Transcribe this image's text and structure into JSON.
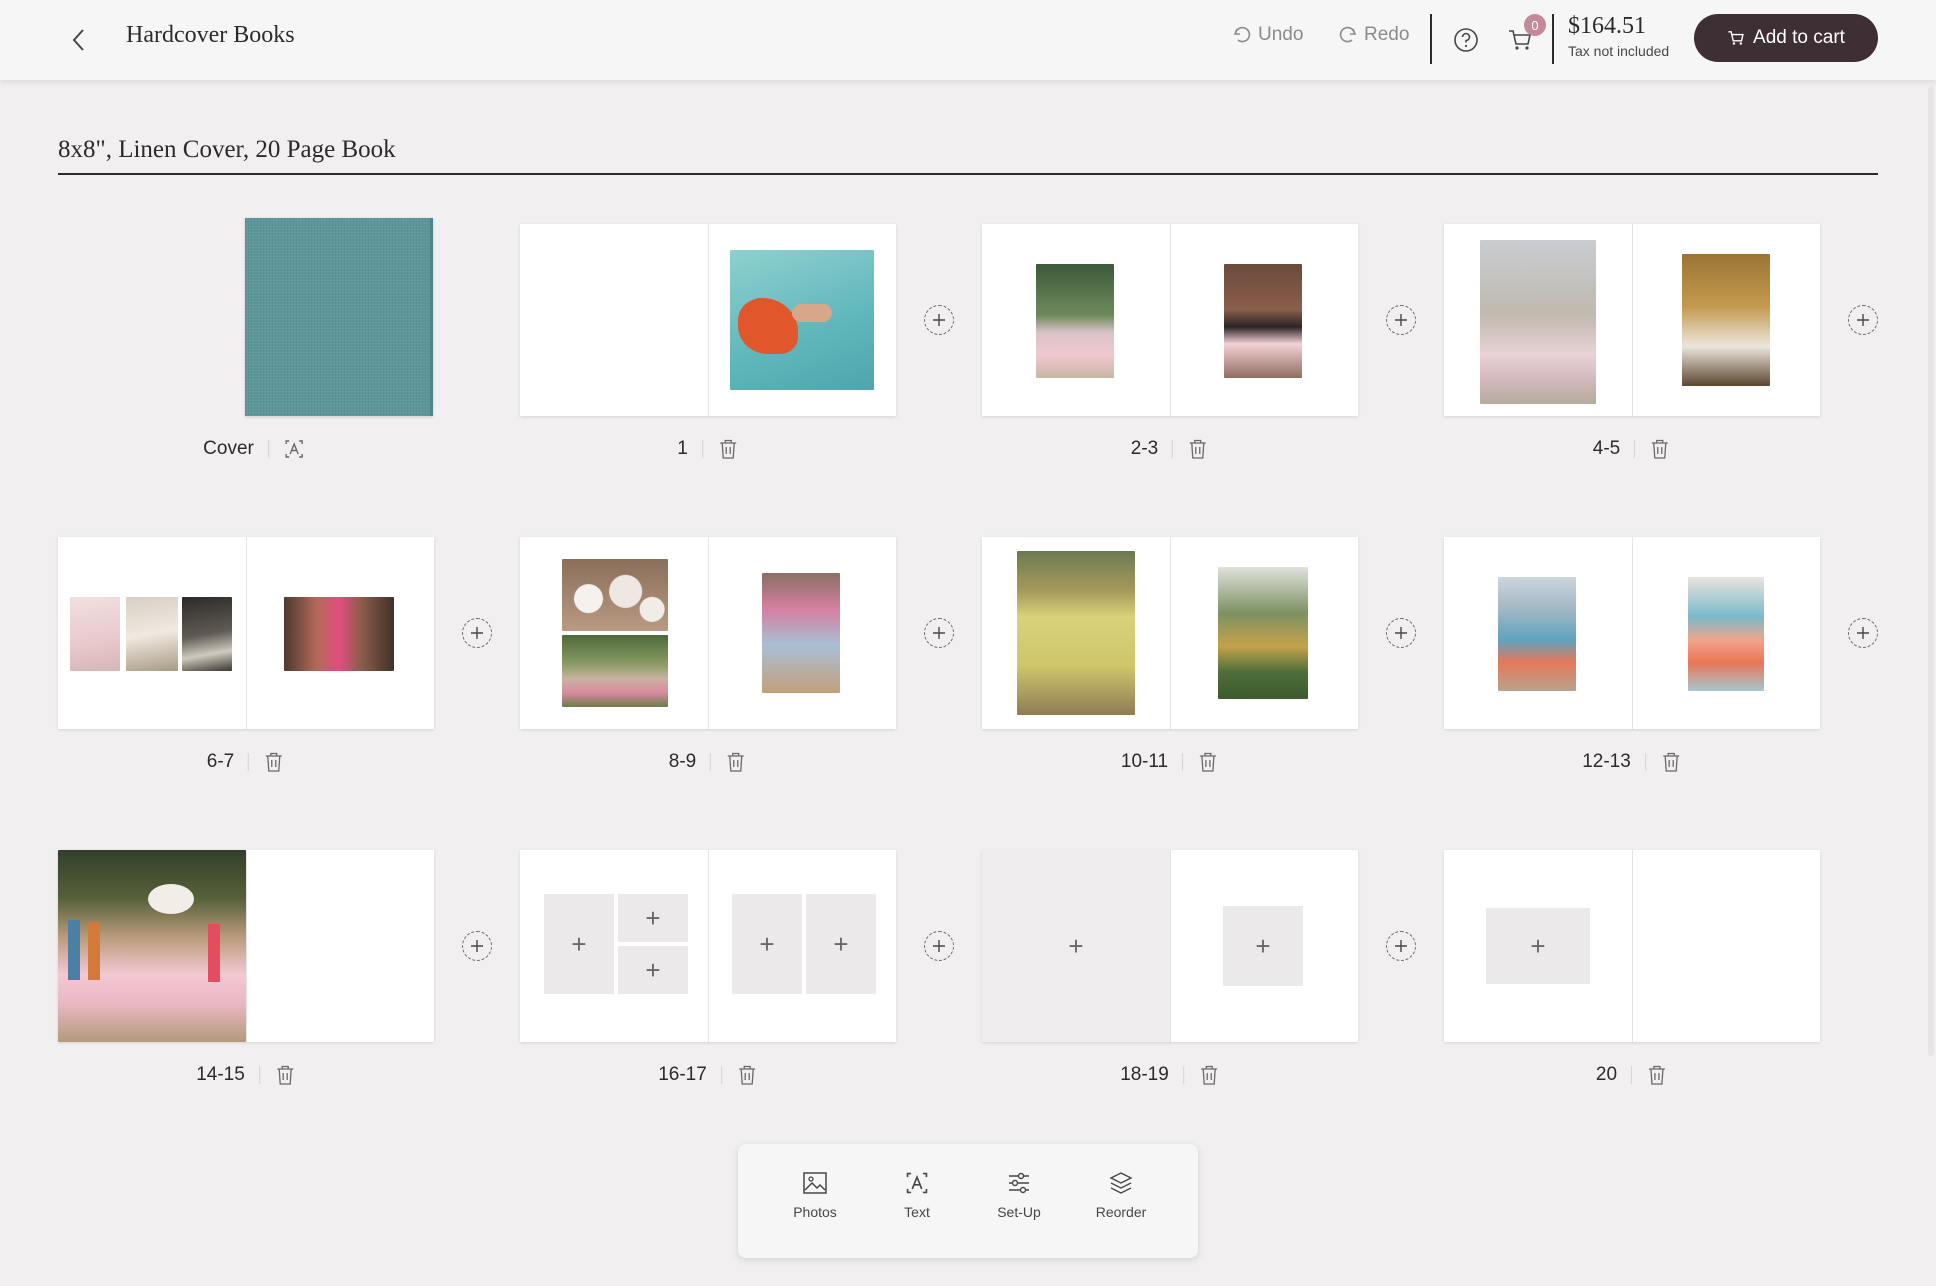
{
  "header": {
    "title": "Hardcover Books",
    "undo_label": "Undo",
    "redo_label": "Redo",
    "cart_count": "0",
    "price": "$164.51",
    "tax_note": "Tax not included",
    "add_to_cart_label": "Add to cart"
  },
  "book": {
    "title": "8x8\", Linen Cover, 20 Page Book",
    "cover_color": "#5e979b"
  },
  "spreads": [
    {
      "label": "Cover",
      "action_icon": "text-icon"
    },
    {
      "label": "1",
      "action_icon": "trash-icon"
    },
    {
      "label": "2-3",
      "action_icon": "trash-icon"
    },
    {
      "label": "4-5",
      "action_icon": "trash-icon"
    },
    {
      "label": "6-7",
      "action_icon": "trash-icon"
    },
    {
      "label": "8-9",
      "action_icon": "trash-icon"
    },
    {
      "label": "10-11",
      "action_icon": "trash-icon"
    },
    {
      "label": "12-13",
      "action_icon": "trash-icon"
    },
    {
      "label": "14-15",
      "action_icon": "trash-icon"
    },
    {
      "label": "16-17",
      "action_icon": "trash-icon"
    },
    {
      "label": "18-19",
      "action_icon": "trash-icon"
    },
    {
      "label": "20",
      "action_icon": "trash-icon"
    }
  ],
  "toolbar": {
    "items": [
      {
        "label": "Photos",
        "icon": "image-icon"
      },
      {
        "label": "Text",
        "icon": "text-icon"
      },
      {
        "label": "Set-Up",
        "icon": "sliders-icon"
      },
      {
        "label": "Reorder",
        "icon": "layers-icon"
      }
    ]
  },
  "colors": {
    "accent": "#3d2f33",
    "badge": "#c28a9a",
    "background": "#f1eff0"
  }
}
